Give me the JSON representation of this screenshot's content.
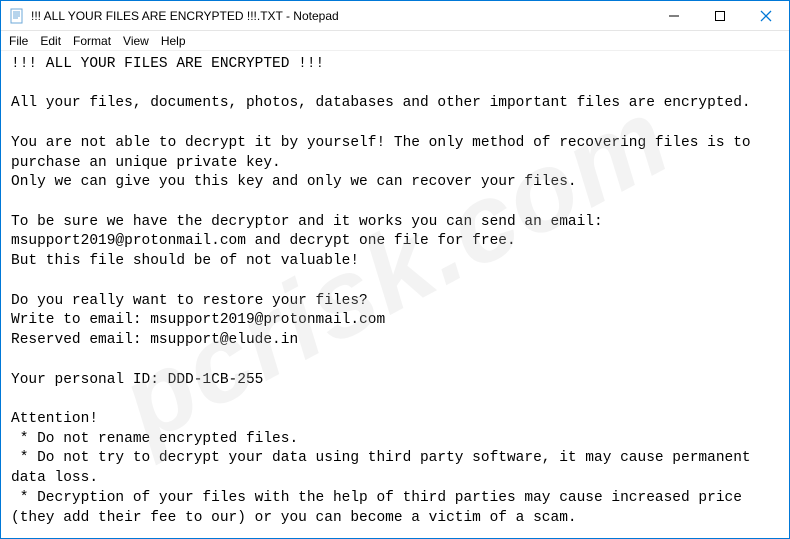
{
  "title": "!!! ALL YOUR FILES ARE ENCRYPTED !!!.TXT - Notepad",
  "menu": {
    "file": "File",
    "edit": "Edit",
    "format": "Format",
    "view": "View",
    "help": "Help"
  },
  "body": "!!! ALL YOUR FILES ARE ENCRYPTED !!!\n\nAll your files, documents, photos, databases and other important files are encrypted.\n\nYou are not able to decrypt it by yourself! The only method of recovering files is to purchase an unique private key.\nOnly we can give you this key and only we can recover your files.\n\nTo be sure we have the decryptor and it works you can send an email: msupport2019@protonmail.com and decrypt one file for free.\nBut this file should be of not valuable!\n\nDo you really want to restore your files?\nWrite to email: msupport2019@protonmail.com\nReserved email: msupport@elude.in\n\nYour personal ID: DDD-1CB-255\n\nAttention!\n * Do not rename encrypted files.\n * Do not try to decrypt your data using third party software, it may cause permanent data loss.\n * Decryption of your files with the help of third parties may cause increased price (they add their fee to our) or you can become a victim of a scam.",
  "watermark": "pcrisk.com"
}
